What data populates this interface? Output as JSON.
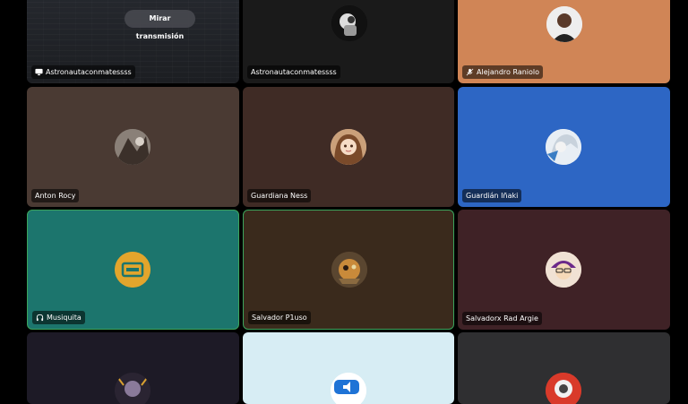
{
  "stream_tile": {
    "watch_button_label": "Mirar transmisión",
    "label": "Astronautaconmatessss",
    "icon": "screen-share-icon"
  },
  "participants": [
    {
      "name": "Astronautaconmatessss",
      "bg": "#1a1a1a"
    },
    {
      "name": "Alejandro Raniolo",
      "bg": "#d08556",
      "icon": "mic-muted-icon"
    },
    {
      "name": "Anton Rocy",
      "bg": "#4a3a33"
    },
    {
      "name": "Guardiana Ness",
      "bg": "#3f2b25"
    },
    {
      "name": "Guardián Iñaki",
      "bg": "#2d66c4"
    },
    {
      "name": "Musiquita",
      "bg": "#1c756d",
      "icon": "headphones-icon",
      "speaking": true
    },
    {
      "name": "Salvador P1uso",
      "bg": "#3a2a1c",
      "speaking": true
    },
    {
      "name": "Salvadorx Rad Argie",
      "bg": "#3f2226"
    },
    {
      "name": "",
      "bg": "#1d1a26"
    },
    {
      "name": "",
      "bg": "#d7edf4"
    },
    {
      "name": "",
      "bg": "#2f2f31"
    }
  ],
  "colors": {
    "speaking_border": "#3ba55c",
    "label_bg": "rgba(0,0,0,0.55)"
  }
}
